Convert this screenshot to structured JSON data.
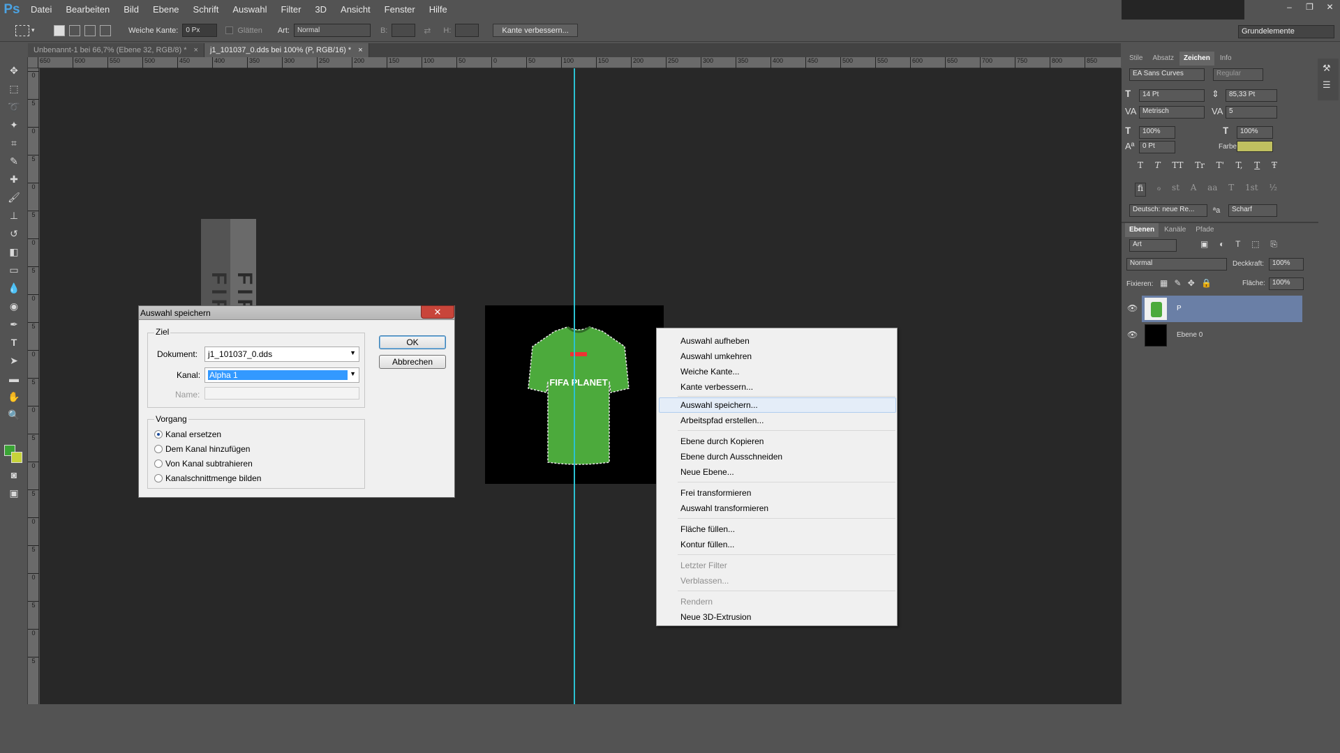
{
  "menubar": {
    "logo": "Ps",
    "items": [
      "Datei",
      "Bearbeiten",
      "Bild",
      "Ebene",
      "Schrift",
      "Auswahl",
      "Filter",
      "3D",
      "Ansicht",
      "Fenster",
      "Hilfe"
    ],
    "window_controls": [
      "–",
      "❐",
      "✕"
    ]
  },
  "options_bar": {
    "soft_edge_label": "Weiche Kante:",
    "soft_edge_value": "0 Px",
    "antialias_label": "Glätten",
    "style_label": "Art:",
    "style_value": "Normal",
    "width_label": "B:",
    "height_label": "H:",
    "refine_button": "Kante verbessern...",
    "workspace": "Grundelemente"
  },
  "tabs": [
    {
      "label": "Unbenannt-1 bei 66,7% (Ebene 32, RGB/8) *",
      "close": "×"
    },
    {
      "label": "j1_101037_0.dds bei 100% (P, RGB/16) *",
      "close": "×"
    }
  ],
  "ruler": {
    "h_ticks": [
      "650",
      "600",
      "550",
      "500",
      "450",
      "400",
      "350",
      "300",
      "250",
      "200",
      "150",
      "100",
      "50",
      "0",
      "50",
      "100",
      "150",
      "200",
      "250",
      "300",
      "350",
      "400",
      "450",
      "500",
      "550",
      "600",
      "650",
      "700",
      "750",
      "800",
      "850"
    ],
    "v_ticks": [
      "0",
      "5",
      "0",
      "5",
      "0",
      "5",
      "0",
      "5",
      "0",
      "5",
      "0",
      "5",
      "0",
      "5",
      "0",
      "5",
      "0",
      "5",
      "0",
      "5",
      "0",
      "5"
    ]
  },
  "canvas": {
    "shirt_text": "FIFA PLANET",
    "overlay_text": "FIFAPLANET"
  },
  "character_panel": {
    "tabs": [
      "Stile",
      "Absatz",
      "Zeichen",
      "Info"
    ],
    "font_family": "EA Sans Curves",
    "font_style": "Regular",
    "font_size": "14 Pt",
    "leading": "85,33 Pt",
    "kerning": "Metrisch",
    "tracking": "5",
    "vscale": "100%",
    "hscale": "100%",
    "baseline": "0 Pt",
    "color_label": "Farbe:",
    "color_value": "#c0c060",
    "style_buttons": [
      "T",
      "T",
      "TT",
      "Tr",
      "T'",
      "T,",
      "T",
      "Ŧ"
    ],
    "opentype_buttons": [
      "fi",
      "ℴ",
      "st",
      "A",
      "aa",
      "T",
      "1st",
      "½"
    ],
    "language": "Deutsch: neue Re...",
    "antialias": "Scharf",
    "aa_label": "ªa"
  },
  "layers_panel": {
    "tabs": [
      "Ebenen",
      "Kanäle",
      "Pfade"
    ],
    "filter": "Art",
    "blend_mode": "Normal",
    "opacity_label": "Deckkraft:",
    "opacity": "100%",
    "lock_label": "Fixieren:",
    "fill_label": "Fläche:",
    "fill": "100%",
    "layers": [
      {
        "name": "P",
        "selected": true
      },
      {
        "name": "Ebene 0",
        "selected": false
      }
    ]
  },
  "dialog": {
    "title": "Auswahl speichern",
    "close": "✕",
    "target_group": "Ziel",
    "document_label": "Dokument:",
    "document_value": "j1_101037_0.dds",
    "channel_label": "Kanal:",
    "channel_value": "Alpha 1",
    "name_label": "Name:",
    "ok": "OK",
    "cancel": "Abbrechen",
    "operation_group": "Vorgang",
    "operations": [
      {
        "label": "Kanal ersetzen",
        "checked": true
      },
      {
        "label": "Dem Kanal hinzufügen",
        "checked": false
      },
      {
        "label": "Von Kanal subtrahieren",
        "checked": false
      },
      {
        "label": "Kanalschnittmenge bilden",
        "checked": false
      }
    ]
  },
  "context_menu": {
    "items": [
      {
        "label": "Auswahl aufheben",
        "enabled": true
      },
      {
        "label": "Auswahl umkehren",
        "enabled": true
      },
      {
        "label": "Weiche Kante...",
        "enabled": true
      },
      {
        "label": "Kante verbessern...",
        "enabled": true
      },
      {
        "label": "Auswahl speichern...",
        "enabled": true,
        "highlighted": true
      },
      {
        "label": "Arbeitspfad erstellen...",
        "enabled": true
      },
      {
        "label": "Ebene durch Kopieren",
        "enabled": true
      },
      {
        "label": "Ebene durch Ausschneiden",
        "enabled": true
      },
      {
        "label": "Neue Ebene...",
        "enabled": true
      },
      {
        "label": "Frei transformieren",
        "enabled": true
      },
      {
        "label": "Auswahl transformieren",
        "enabled": true
      },
      {
        "label": "Fläche füllen...",
        "enabled": true
      },
      {
        "label": "Kontur füllen...",
        "enabled": true
      },
      {
        "label": "Letzter Filter",
        "enabled": false
      },
      {
        "label": "Verblassen...",
        "enabled": false
      },
      {
        "label": "Rendern",
        "enabled": false
      },
      {
        "label": "Neue 3D-Extrusion",
        "enabled": true
      }
    ]
  },
  "colors": {
    "foreground": "#3aa335",
    "background": "#c6d33a",
    "guide": "#2bc2d2"
  }
}
